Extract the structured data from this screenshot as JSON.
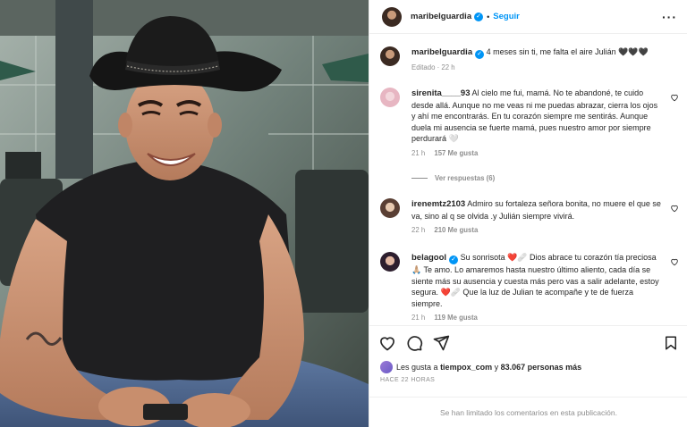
{
  "header": {
    "username": "maribelguardia",
    "follow_label": "Seguir",
    "separator": "•",
    "more_icon": "more-icon"
  },
  "caption": {
    "username": "maribelguardia",
    "text": "4 meses sin ti, me falta el aire Julián 🖤🖤🖤",
    "edited": "Editado · 22 h"
  },
  "comments": [
    {
      "username": "sirenita____93",
      "text": "Al cielo me fui, mamá. No te abandoné, te cuido desde allá. Aunque no me veas ni me puedas abrazar, cierra los ojos y ahí me encontrarás. En tu corazón siempre me sentirás. Aunque duela mi ausencia se fuerte mamá, pues nuestro amor por siempre perdurará 🤍",
      "time": "21 h",
      "likes": "157 Me gusta",
      "replies": "Ver respuestas (6)"
    },
    {
      "username": "irenemtz2103",
      "text": "Admiro su fortaleza señora bonita, no muere el que se va, sino al q se olvida .y Julián siempre vivirá.",
      "time": "22 h",
      "likes": "210 Me gusta"
    },
    {
      "username": "belagool",
      "text": "Su sonrisota ❤️🩹 Dios abrace tu corazón tía preciosa 🙏🏼 Te amo. Lo amaremos hasta nuestro último aliento, cada día se siente más su ausencia y cuesta más pero vas a salir adelante, estoy segura. ❤️🩹 Que la luz de Julian te acompañe y te de fuerza siempre.",
      "time": "21 h",
      "likes": "119 Me gusta"
    }
  ],
  "actions": {
    "likes_prefix": "Les gusta a",
    "likes_user": "tiempox_com",
    "likes_middle": "y",
    "likes_count": "83.067 personas más",
    "time_ago": "HACE 22 HORAS"
  },
  "footer": {
    "limited_text": "Se han limitado los comentarios en esta publicación."
  },
  "colors": {
    "accent": "#0095f6",
    "muted": "#8e8e8e",
    "text": "#262626"
  }
}
